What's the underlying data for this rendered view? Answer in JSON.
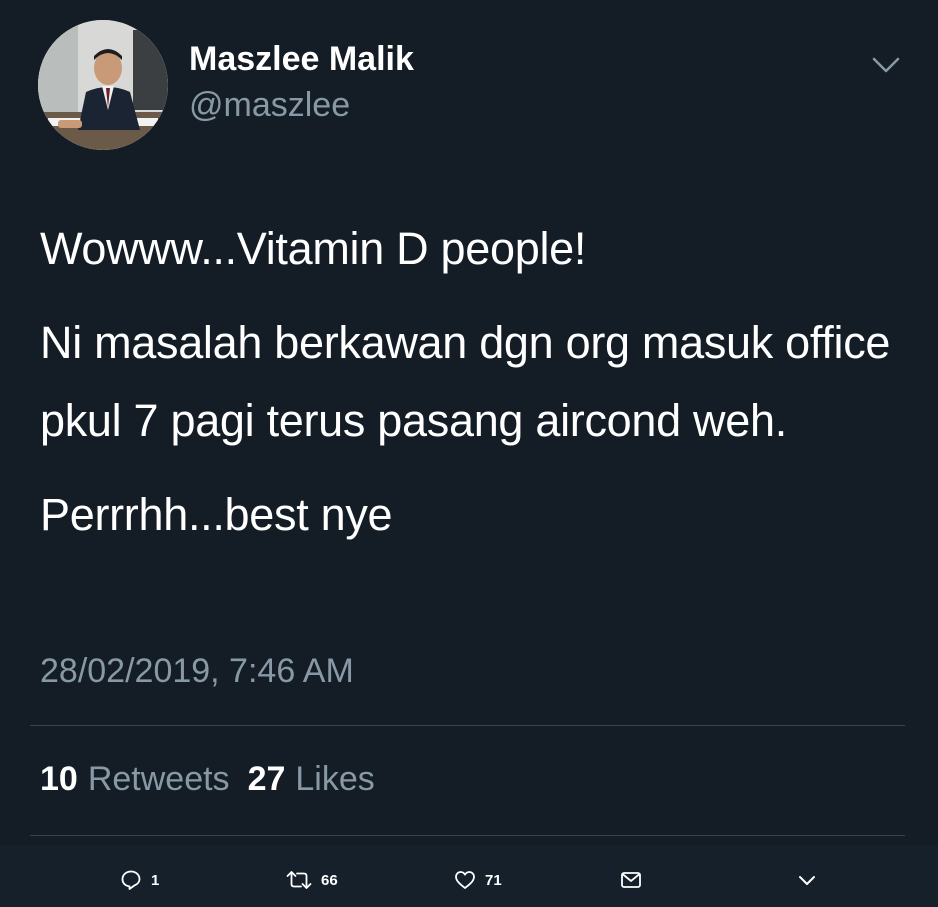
{
  "user": {
    "display_name": "Maszlee Malik",
    "handle": "@maszlee"
  },
  "tweet": {
    "paragraphs": [
      "Wowww...Vitamin D people!",
      "Ni masalah berkawan dgn org masuk office pkul 7 pagi terus pasang aircond weh.",
      "Perrrhh...best nye"
    ],
    "timestamp": "28/02/2019, 7:46 AM"
  },
  "stats": {
    "retweets_count": "10",
    "retweets_label": "Retweets",
    "likes_count": "27",
    "likes_label": "Likes"
  },
  "actions": {
    "reply_count": "1",
    "retweet_count": "66",
    "like_count": "71"
  },
  "icons": {
    "caret": "chevron-down-icon",
    "reply": "reply-icon",
    "retweet": "retweet-icon",
    "like": "heart-icon",
    "dm": "envelope-icon",
    "more": "chevron-down-icon"
  },
  "colors": {
    "background": "#141d26",
    "text": "#ffffff",
    "secondary_text": "#8899a6",
    "divider": "#38444d"
  }
}
